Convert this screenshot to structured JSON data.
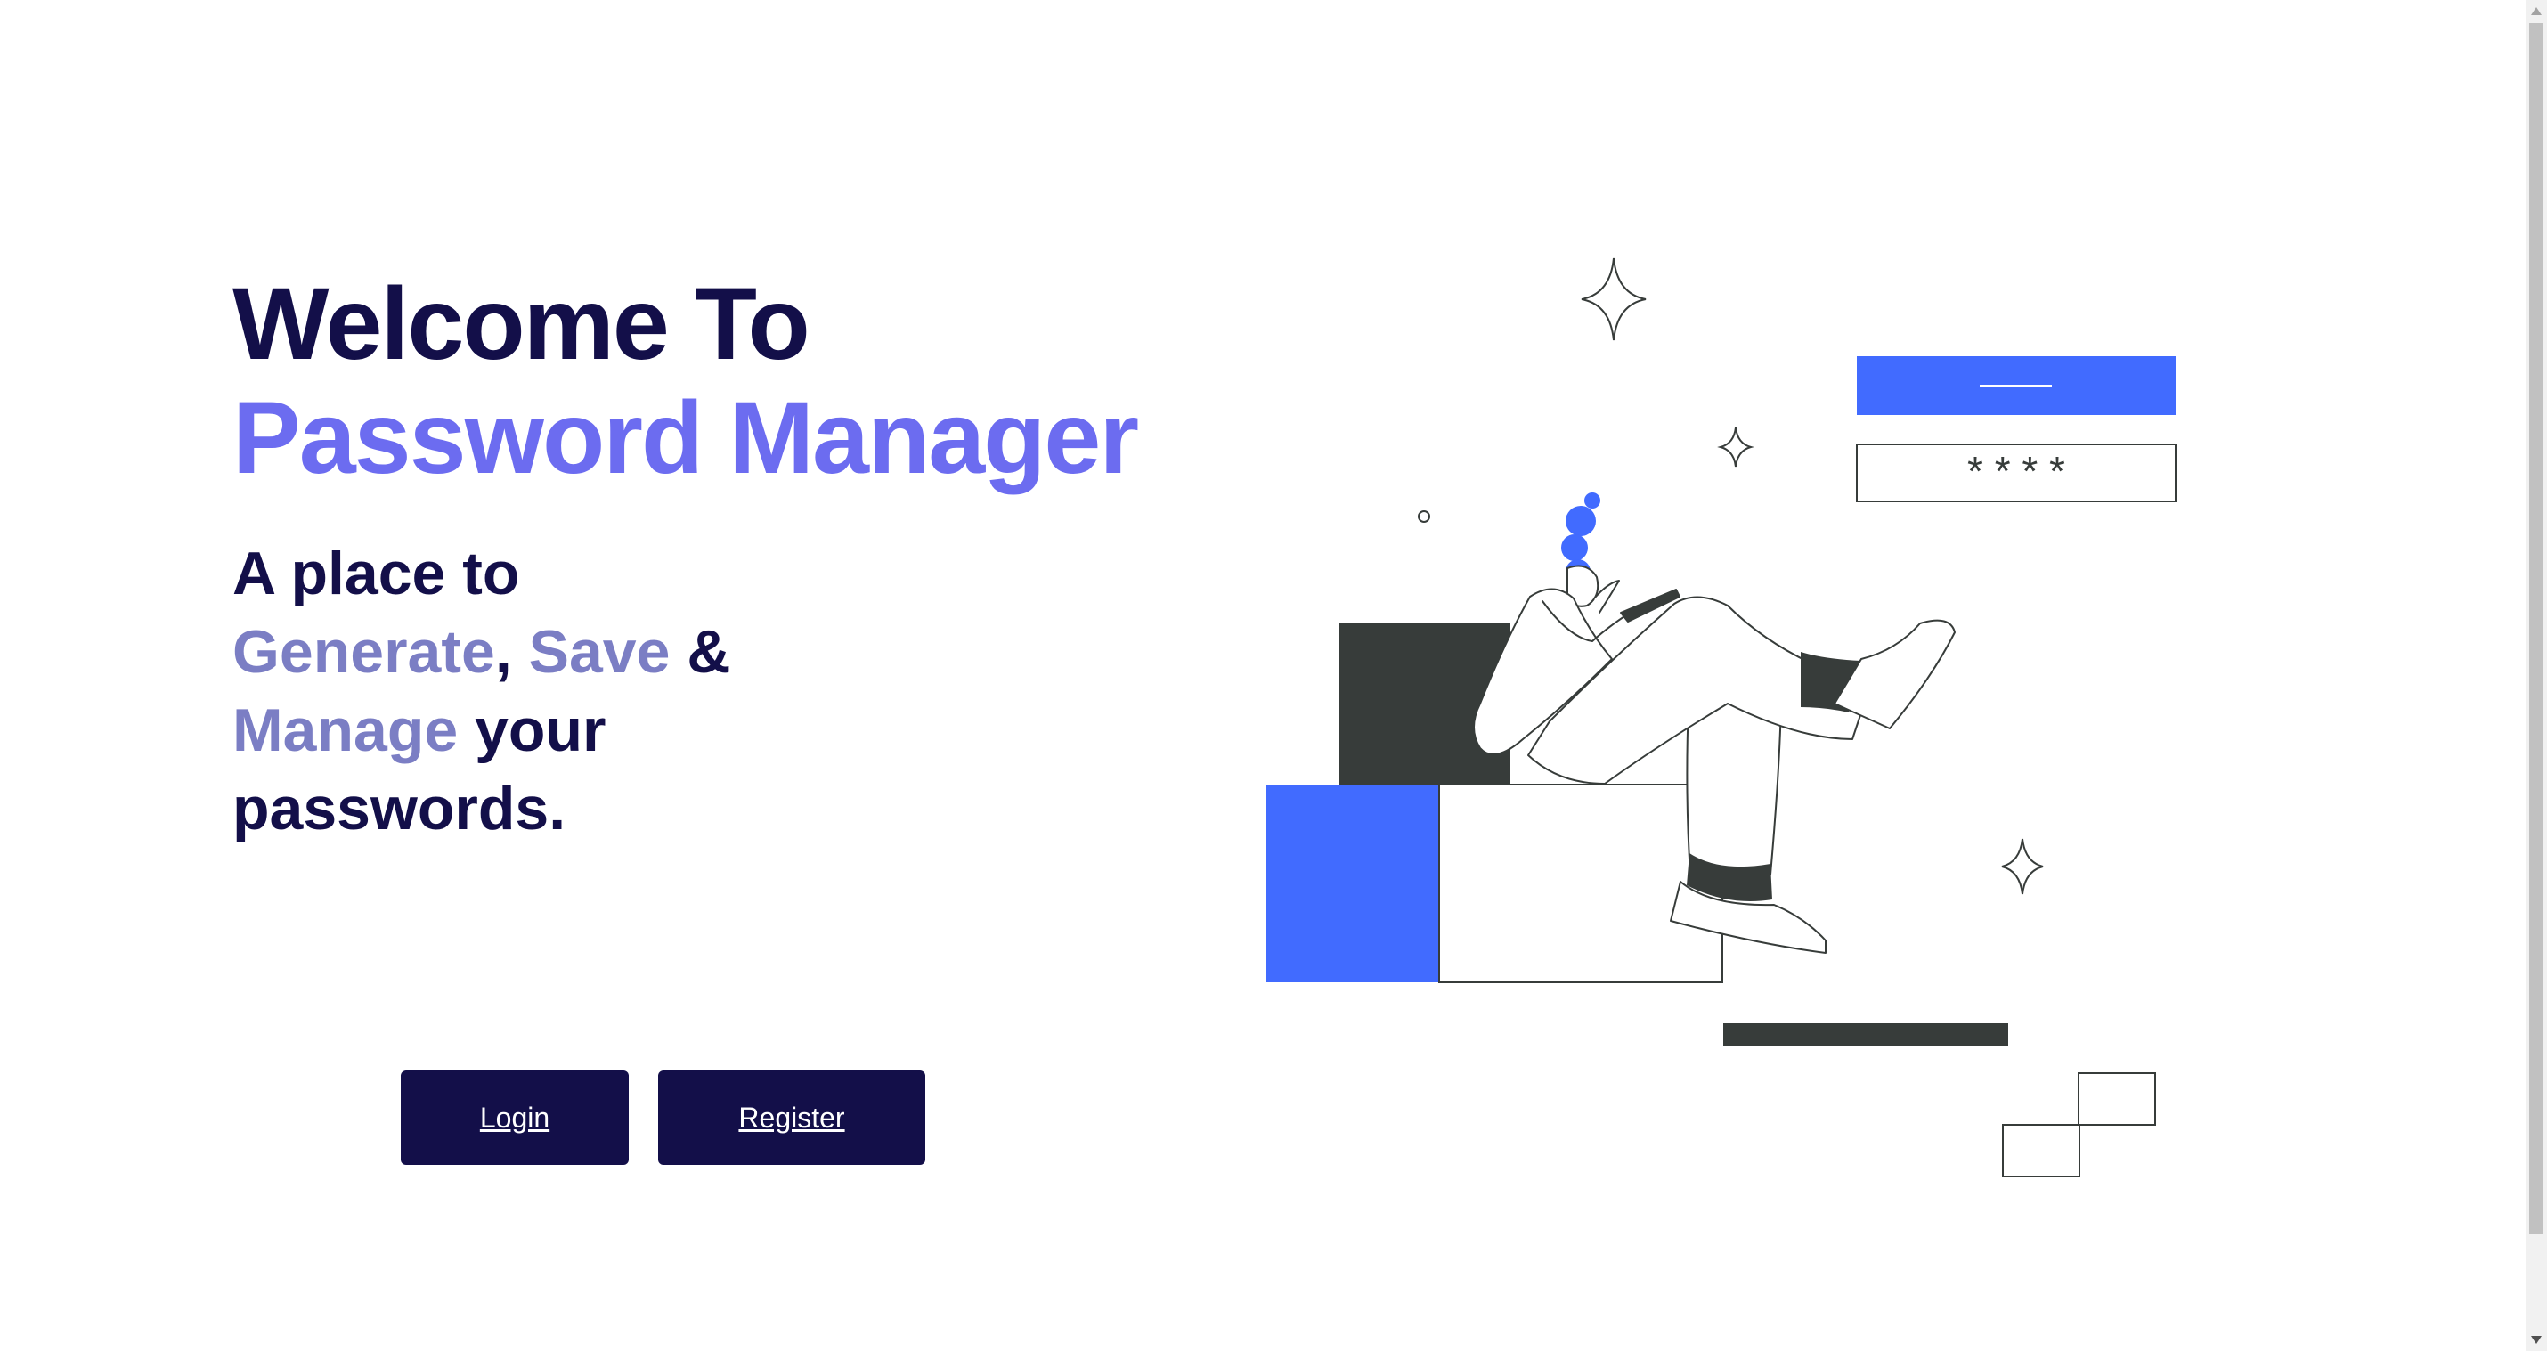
{
  "hero": {
    "title_line1": "Welcome To",
    "title_line2": "Password Manager",
    "tagline": {
      "line1": "A place to",
      "generate": "Generate",
      "comma": ",",
      "save": "Save",
      "amp": "&",
      "manage": "Manage",
      "your": "your",
      "line4": "passwords."
    }
  },
  "buttons": {
    "login_label": "Login",
    "register_label": "Register"
  },
  "illustration": {
    "masked_password": "* * * *"
  },
  "colors": {
    "navy": "#130f49",
    "accent_purple": "#6c6cf0",
    "muted_purple": "#7b7ec4",
    "illustration_blue": "#416bff",
    "illustration_dark": "#373c3a"
  }
}
